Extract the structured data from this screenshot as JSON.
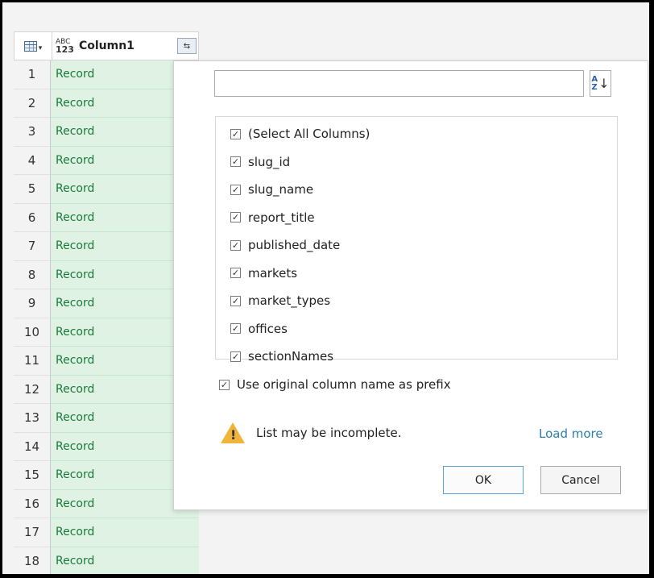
{
  "grid": {
    "column_type_top": "ABC",
    "column_type_bottom": "123",
    "column_name": "Column1",
    "expand_icon": "expand-columns-icon",
    "rows": [
      {
        "num": "1",
        "value": "Record"
      },
      {
        "num": "2",
        "value": "Record"
      },
      {
        "num": "3",
        "value": "Record"
      },
      {
        "num": "4",
        "value": "Record"
      },
      {
        "num": "5",
        "value": "Record"
      },
      {
        "num": "6",
        "value": "Record"
      },
      {
        "num": "7",
        "value": "Record"
      },
      {
        "num": "8",
        "value": "Record"
      },
      {
        "num": "9",
        "value": "Record"
      },
      {
        "num": "10",
        "value": "Record"
      },
      {
        "num": "11",
        "value": "Record"
      },
      {
        "num": "12",
        "value": "Record"
      },
      {
        "num": "13",
        "value": "Record"
      },
      {
        "num": "14",
        "value": "Record"
      },
      {
        "num": "15",
        "value": "Record"
      },
      {
        "num": "16",
        "value": "Record"
      },
      {
        "num": "17",
        "value": "Record"
      },
      {
        "num": "18",
        "value": "Record"
      }
    ]
  },
  "popup": {
    "search_value": "",
    "sort_letters": [
      "A",
      "Z"
    ],
    "columns": [
      {
        "label": "(Select All Columns)",
        "checked": true
      },
      {
        "label": "slug_id",
        "checked": true
      },
      {
        "label": "slug_name",
        "checked": true
      },
      {
        "label": "report_title",
        "checked": true
      },
      {
        "label": "published_date",
        "checked": true
      },
      {
        "label": "markets",
        "checked": true
      },
      {
        "label": "market_types",
        "checked": true
      },
      {
        "label": "offices",
        "checked": true
      },
      {
        "label": "sectionNames",
        "checked": true
      }
    ],
    "prefix_label": "Use original column name as prefix",
    "prefix_checked": true,
    "warning_text": "List may be incomplete.",
    "load_more": "Load more",
    "ok_label": "OK",
    "cancel_label": "Cancel"
  },
  "colors": {
    "record_text": "#1a7a3a",
    "record_bg": "#dff2e4",
    "link": "#2a7fa8",
    "warning": "#f0b43a",
    "ok_border": "#5aa0d0"
  }
}
